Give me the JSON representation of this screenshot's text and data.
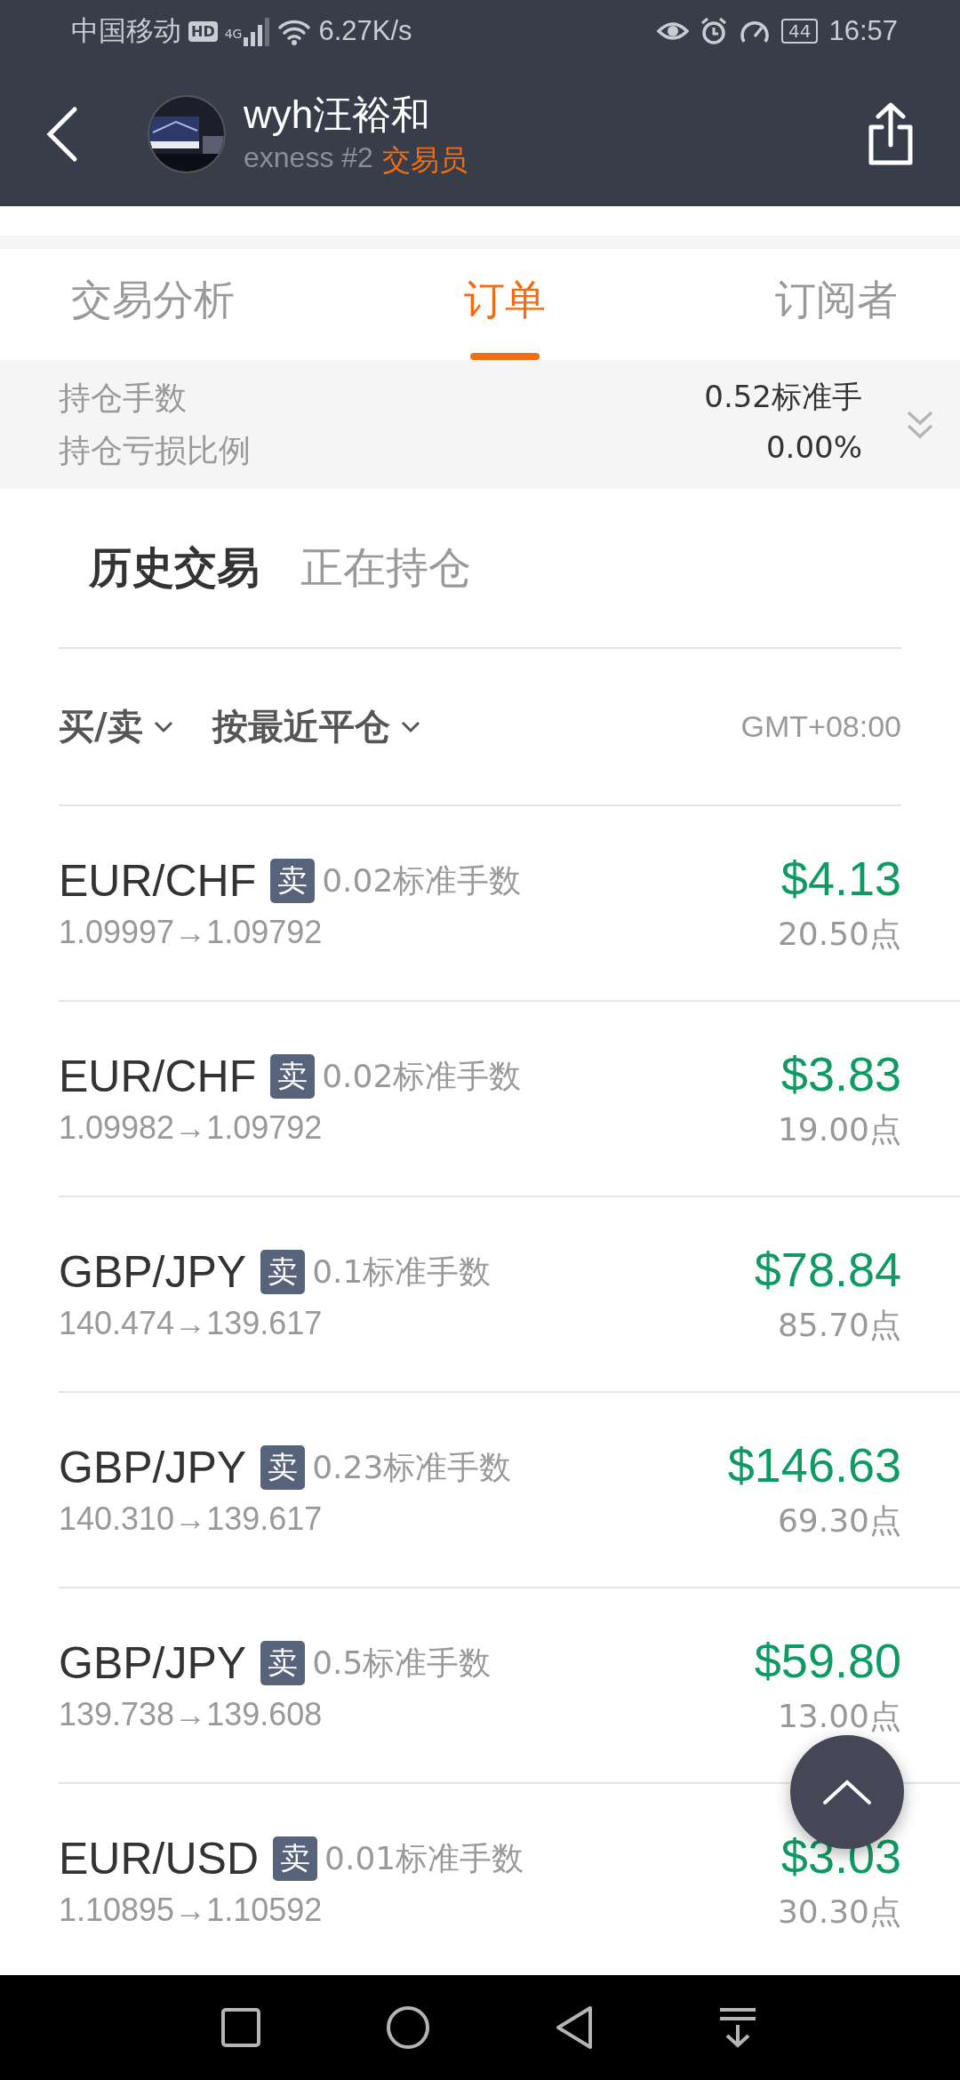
{
  "status_bar": {
    "carrier": "中国移动",
    "hd": "HD",
    "network": "4G",
    "speed": "6.27K/s",
    "battery": "44",
    "time": "16:57"
  },
  "header": {
    "name": "wyh汪裕和",
    "broker": "exness #2",
    "role": "交易员"
  },
  "tabs": [
    {
      "label": "交易分析",
      "selected": false
    },
    {
      "label": "订单",
      "selected": true
    },
    {
      "label": "订阅者",
      "selected": false
    }
  ],
  "summary": [
    {
      "label": "持仓手数",
      "value": "0.52标准手"
    },
    {
      "label": "持仓亏损比例",
      "value": "0.00%"
    }
  ],
  "subtabs": [
    {
      "label": "历史交易",
      "selected": true
    },
    {
      "label": "正在持仓",
      "selected": false
    }
  ],
  "filters": [
    {
      "label": "买/卖"
    },
    {
      "label": "按最近平仓"
    }
  ],
  "timezone": "GMT+08:00",
  "orders": [
    {
      "symbol": "EUR/CHF",
      "side": "卖",
      "lots": "0.02标准手数",
      "prices": "1.09997→1.09792",
      "profit": "$4.13",
      "points": "20.50点"
    },
    {
      "symbol": "EUR/CHF",
      "side": "卖",
      "lots": "0.02标准手数",
      "prices": "1.09982→1.09792",
      "profit": "$3.83",
      "points": "19.00点"
    },
    {
      "symbol": "GBP/JPY",
      "side": "卖",
      "lots": "0.1标准手数",
      "prices": "140.474→139.617",
      "profit": "$78.84",
      "points": "85.70点"
    },
    {
      "symbol": "GBP/JPY",
      "side": "卖",
      "lots": "0.23标准手数",
      "prices": "140.310→139.617",
      "profit": "$146.63",
      "points": "69.30点"
    },
    {
      "symbol": "GBP/JPY",
      "side": "卖",
      "lots": "0.5标准手数",
      "prices": "139.738→139.608",
      "profit": "$59.80",
      "points": "13.00点"
    },
    {
      "symbol": "EUR/USD",
      "side": "卖",
      "lots": "0.01标准手数",
      "prices": "1.10895→1.10592",
      "profit": "$3.03",
      "points": "30.30点"
    }
  ]
}
